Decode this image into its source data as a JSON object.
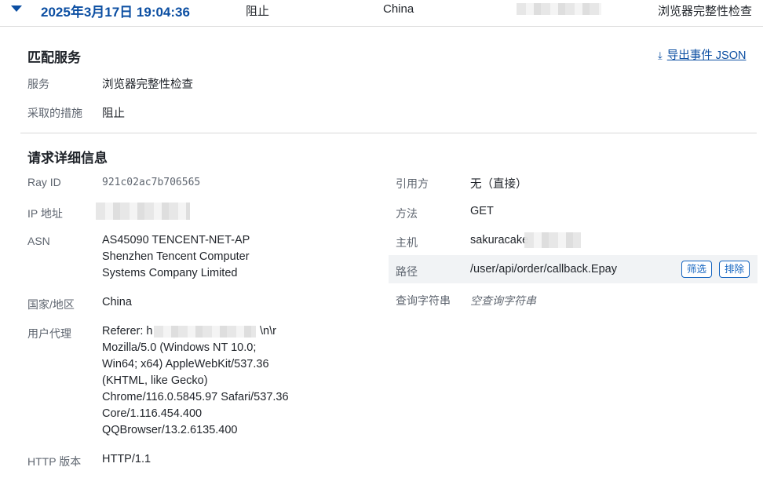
{
  "event_header": {
    "timestamp": "2025年3月17日 19:04:36",
    "action": "阻止",
    "country": "China",
    "service": "浏览器完整性检查"
  },
  "matched_service": {
    "title": "匹配服务",
    "export_label": "导出事件 JSON",
    "fields": [
      {
        "label": "服务",
        "value": "浏览器完整性检查"
      },
      {
        "label": "采取的措施",
        "value": "阻止"
      }
    ]
  },
  "request_details": {
    "title": "请求详细信息",
    "left": {
      "ray_id": {
        "label": "Ray ID",
        "value": "921c02ac7b706565"
      },
      "ip": {
        "label": "IP 地址"
      },
      "asn": {
        "label": "ASN",
        "lines": [
          "AS45090 TENCENT-NET-AP",
          "Shenzhen Tencent Computer",
          "Systems Company Limited"
        ]
      },
      "country": {
        "label": "国家/地区",
        "value": "China"
      },
      "user_agent": {
        "label": "用户代理",
        "referer_prefix": "Referer:  h",
        "referer_suffix": "\\n\\r",
        "lines": [
          "Mozilla/5.0 (Windows NT 10.0;",
          "Win64; x64) AppleWebKit/537.36",
          "(KHTML, like Gecko)",
          "Chrome/116.0.5845.97 Safari/537.36",
          "Core/1.116.454.400",
          "QQBrowser/13.2.6135.400"
        ]
      },
      "http_version": {
        "label": "HTTP 版本",
        "value": "HTTP/1.1"
      }
    },
    "right": {
      "referrer": {
        "label": "引用方",
        "value": "无（直接）"
      },
      "method": {
        "label": "方法",
        "value": "GET"
      },
      "host": {
        "label": "主机",
        "value": "sakuracake"
      },
      "path": {
        "label": "路径",
        "value": "/user/api/order/callback.Epay",
        "filter_label": "筛选",
        "exclude_label": "排除"
      },
      "query": {
        "label": "查询字符串",
        "value": "空查询字符串"
      }
    }
  },
  "colors": {
    "accent": "#0b4ea2",
    "link": "#1565c0",
    "row_highlight": "#f1f3f5"
  },
  "icons": {
    "expand": "caret-down-icon",
    "download": "download-icon"
  }
}
